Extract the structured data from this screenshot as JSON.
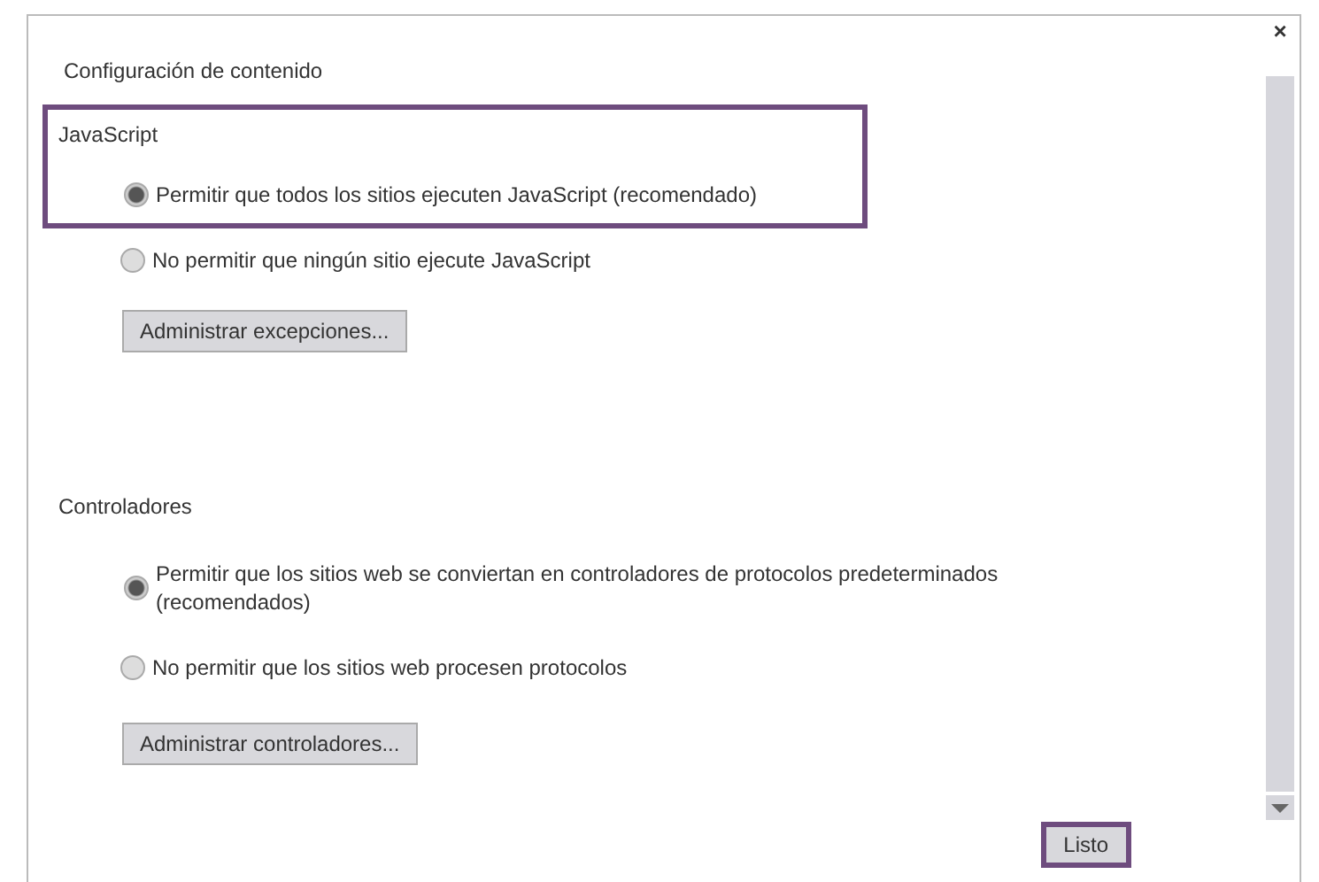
{
  "dialog": {
    "title": "Configuración de contenido",
    "close": "×"
  },
  "sections": [
    {
      "heading": "JavaScript",
      "highlighted": true,
      "options": [
        {
          "label": "Permitir que todos los sitios ejecuten JavaScript (recomendado)",
          "selected": true
        },
        {
          "label": "No permitir que ningún sitio ejecute JavaScript",
          "selected": false
        }
      ],
      "button": "Administrar excepciones..."
    },
    {
      "heading": "Controladores",
      "highlighted": false,
      "options": [
        {
          "label": "Permitir que los sitios web se conviertan en controladores de protocolos predeterminados (recomendados)",
          "selected": true
        },
        {
          "label": "No permitir  que los sitios web procesen protocolos",
          "selected": false
        }
      ],
      "button": "Administrar controladores..."
    }
  ],
  "done_button": {
    "label": "Listo",
    "highlighted": true
  }
}
